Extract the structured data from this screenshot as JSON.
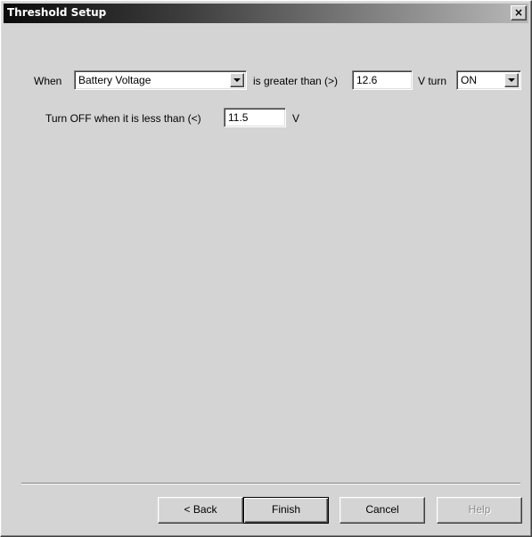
{
  "window": {
    "title": "Threshold Setup",
    "close_glyph": "×",
    "close_icon": "close-icon"
  },
  "rule": {
    "when_label": "When",
    "source_value": "Battery Voltage",
    "comparison_label": "is greater than (>)",
    "on_threshold_value": "12.6",
    "unit_turn_label": "V turn",
    "state_value": "ON",
    "off_label": "Turn OFF when it is less than (<)",
    "off_threshold_value": "11.5",
    "off_unit_label": "V"
  },
  "buttons": {
    "back": "< Back",
    "finish": "Finish",
    "cancel": "Cancel",
    "help": "Help"
  }
}
